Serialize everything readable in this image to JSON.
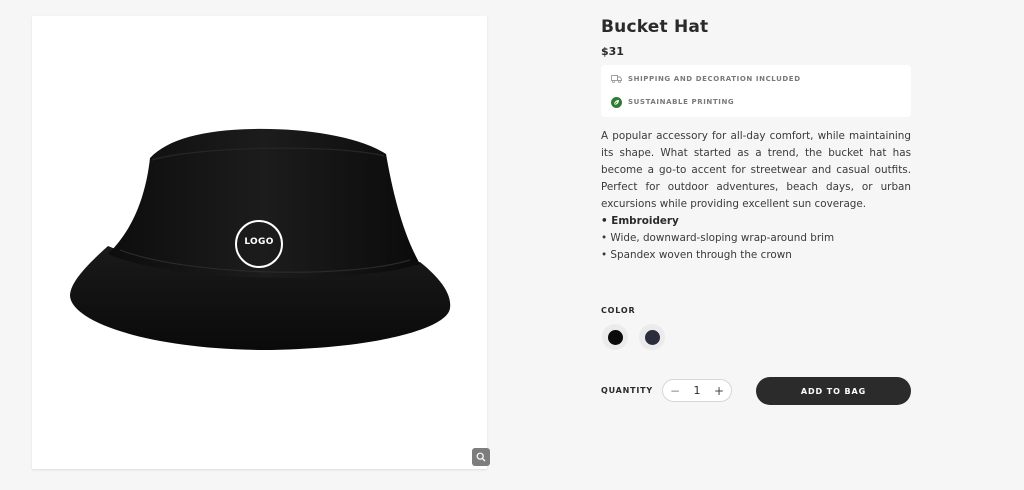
{
  "product": {
    "title": "Bucket Hat",
    "price": "$31",
    "image": {
      "logo_text": "LOGO",
      "zoom_icon": "magnifier-icon"
    },
    "features": [
      {
        "icon": "truck-icon",
        "label": "SHIPPING AND DECORATION INCLUDED",
        "color": "#9a9a9a"
      },
      {
        "icon": "leaf-icon",
        "label": "SUSTAINABLE PRINTING",
        "color": "#2e7d32"
      }
    ],
    "description": "A popular accessory for all-day comfort, while maintaining its shape. What started as a trend, the bucket hat has become a go-to accent for streetwear and casual outfits. Perfect for outdoor adventures, beach days, or urban excursions while providing excellent sun coverage.",
    "bullets": [
      "• Embroidery",
      "• Wide, downward-sloping wrap-around brim",
      "• Spandex woven through the crown"
    ]
  },
  "color": {
    "label": "COLOR",
    "options": [
      {
        "name": "black",
        "hex": "#0b0b0b",
        "selected": true
      },
      {
        "name": "navy",
        "hex": "#2b2d3c",
        "selected": false
      }
    ]
  },
  "quantity": {
    "label": "QUANTITY",
    "value": "1",
    "minus": "−",
    "plus": "+"
  },
  "cta": {
    "add_to_bag": "ADD TO BAG",
    "color": "#2b2b2b"
  }
}
